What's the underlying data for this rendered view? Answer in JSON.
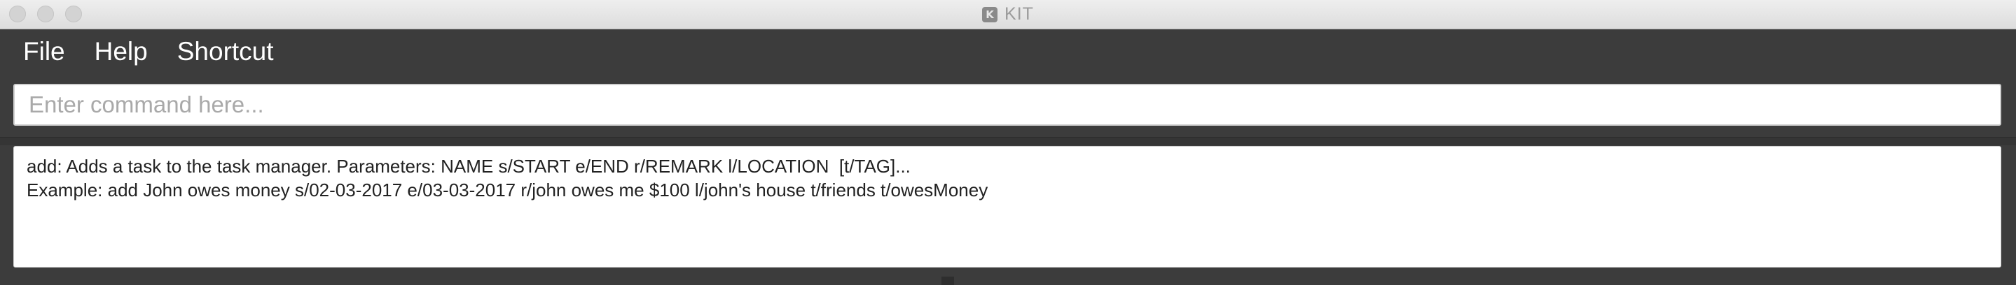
{
  "window": {
    "title": "KIT",
    "app_icon_letter": "K"
  },
  "menu": {
    "items": [
      {
        "label": "File"
      },
      {
        "label": "Help"
      },
      {
        "label": "Shortcut"
      }
    ]
  },
  "command": {
    "placeholder": "Enter command here...",
    "value": ""
  },
  "result": {
    "lines": [
      "add: Adds a task to the task manager. Parameters: NAME s/START e/END r/REMARK l/LOCATION  [t/TAG]...",
      "Example: add John owes money s/02-03-2017 e/03-03-2017 r/john owes me $100 l/john's house t/friends t/owesMoney"
    ]
  },
  "colors": {
    "menu_bg": "#3c3c3c",
    "titlebar_bg": "#e6e6e6",
    "input_bg": "#ffffff"
  }
}
